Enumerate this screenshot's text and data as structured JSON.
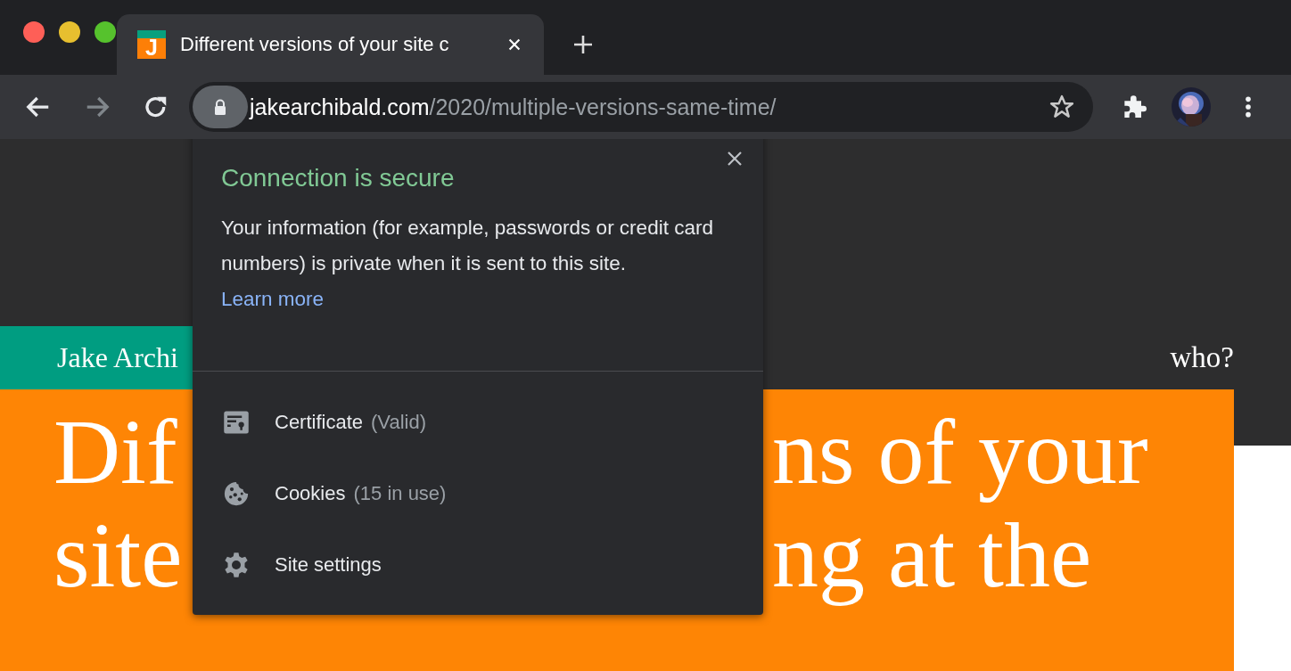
{
  "window": {
    "traffic_lights": [
      {
        "color": "#fe5f57"
      },
      {
        "color": "#e7bf2f"
      },
      {
        "color": "#56c22d"
      }
    ]
  },
  "tabs": [
    {
      "favicon_letter": "J",
      "title": "Different versions of your site c",
      "selected": true
    }
  ],
  "toolbar": {
    "nav_buttons": [
      {
        "kind": "back",
        "disabled": false
      },
      {
        "kind": "forward",
        "disabled": true
      },
      {
        "kind": "reload",
        "disabled": false
      }
    ],
    "address": {
      "host": "jakearchibald.com",
      "path": "/2020/multiple-versions-same-time/"
    }
  },
  "page": {
    "site_name": "Jake Archi",
    "nav_link": "who?",
    "heading_lines": [
      {
        "left": "Dif",
        "right": "ns of your"
      },
      {
        "left": "site",
        "right": "ng at the"
      }
    ]
  },
  "site_info_popup": {
    "title": "Connection is secure",
    "body": "Your information (for example, passwords or credit card numbers) is private when it is sent to this site.",
    "link": "Learn more",
    "items": [
      {
        "kind": "certificate",
        "label": "Certificate",
        "detail": "(Valid)"
      },
      {
        "kind": "cookies",
        "label": "Cookies",
        "detail": "(15 in use)"
      },
      {
        "kind": "settings",
        "label": "Site settings"
      }
    ]
  }
}
